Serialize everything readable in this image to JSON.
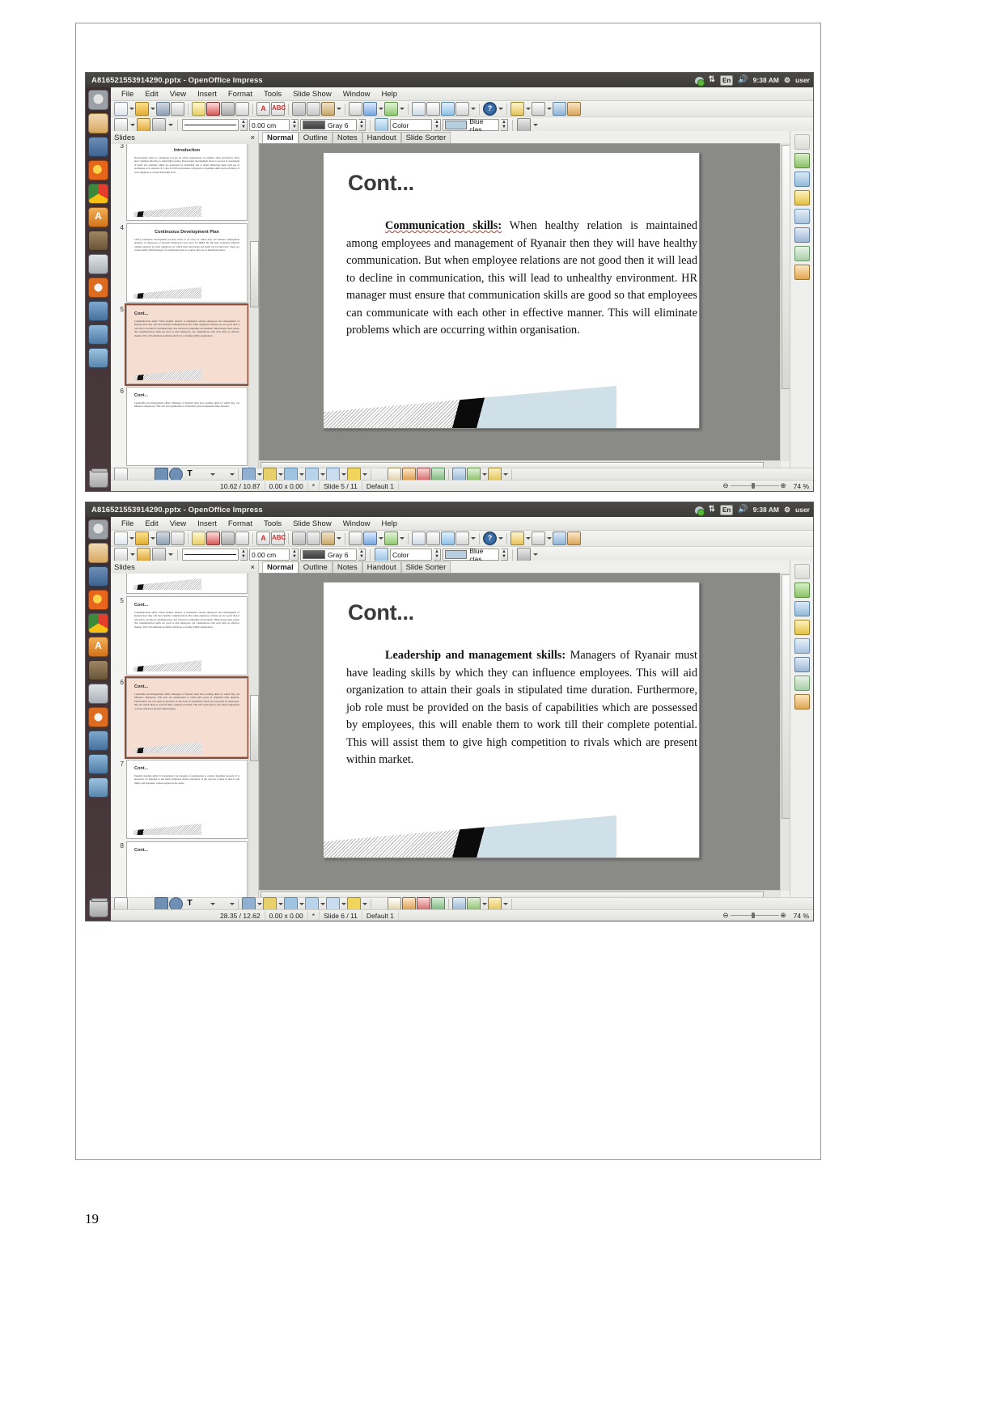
{
  "document": {
    "page_number": "19"
  },
  "windows": [
    {
      "title": "A816521553914290.pptx - OpenOffice Impress",
      "tray": {
        "lang": "En",
        "clock": "9:38 AM",
        "user": "user"
      },
      "menu": [
        "File",
        "Edit",
        "View",
        "Insert",
        "Format",
        "Tools",
        "Slide Show",
        "Window",
        "Help"
      ],
      "formatbar": {
        "line_width": "0.00 cm",
        "line_color": "Gray 6",
        "area_style": "Color",
        "area_color": "Blue clas"
      },
      "slides_pane": {
        "label": "Slides",
        "close": "×"
      },
      "view_tabs": [
        "Normal",
        "Outline",
        "Notes",
        "Handout",
        "Slide Sorter"
      ],
      "active_tab": "Normal",
      "thumbnails": [
        {
          "num": "3",
          "title": "Introduction",
          "title_align": "center",
          "body": "Development refers to continuous process by which organisation can enhance their proficiency. They have common objective to attain high revenue. Professional development refers to process of assessment of skills and qualities which are possessed by individual and is attain enhancing them with use of techniques or be ensured. It is also in CPD professional at Ryanair to maximise skills and proficiency of each employee at overall individual level."
        },
        {
          "num": "4",
          "title": "Continuous Development Plan",
          "title_align": "center",
          "body": "CPD (Continuous development process) refers to an array by which they can enhance employment qualities of employees of Ryanair. Employees have need for HRM. By this they formulate different training sessions for their employees by which their knowledge and skills can be improved. There are various skills which manager of organisation need to acquire, they are as mentioned below:"
        },
        {
          "num": "5",
          "title": "Cont...",
          "title_align": "left",
          "selected": true,
          "body": "Communication skills: When healthy relation is maintained among employees and management of Ryanair then they will have healthy communication. But when employee relations are not good then it will lead to decline in communication, this will lead to unhealthy environment. HR manager must ensure that communication skills are good so that employees can communicate with each other in effective manner. This will eliminate problems which are occurring within organisation."
        },
        {
          "num": "6",
          "title": "Cont...",
          "title_align": "left",
          "body": "Leadership and management skills: Managers of Ryanair must have leading skills by which they can influence employees. This will aid organization to attain their goals in stipulated time duration."
        }
      ],
      "slide": {
        "title": "Cont...",
        "lead": "Communication skills:",
        "body": " When healthy relation is maintained among employees and management of Ryanair then they will have healthy communication. But when employee relations are not good then it will lead to decline in communication, this will lead to unhealthy environment. HR manager must ensure that communication skills are good so that employees can communicate with each other in effective manner. This will eliminate problems which are occurring within organisation."
      },
      "status": {
        "position": "10.62 / 10.87",
        "size": "0.00 x 0.00",
        "modified": "*",
        "slide_counter": "Slide 5 / 11",
        "master": "Default 1",
        "zoom": "74 %"
      }
    },
    {
      "title": "A816521553914290.pptx - OpenOffice Impress",
      "tray": {
        "lang": "En",
        "clock": "9:38 AM",
        "user": "user"
      },
      "menu": [
        "File",
        "Edit",
        "View",
        "Insert",
        "Format",
        "Tools",
        "Slide Show",
        "Window",
        "Help"
      ],
      "formatbar": {
        "line_width": "0.00 cm",
        "line_color": "Gray 6",
        "area_style": "Color",
        "area_color": "Blue clas"
      },
      "slides_pane": {
        "label": "Slides",
        "close": "×"
      },
      "view_tabs": [
        "Normal",
        "Outline",
        "Notes",
        "Handout",
        "Slide Sorter"
      ],
      "active_tab": "Normal",
      "thumbnails": [
        {
          "num": "",
          "title": "",
          "title_align": "left",
          "body": ""
        },
        {
          "num": "5",
          "title": "Cont...",
          "title_align": "left",
          "body": "Communication skills: When healthy relation is maintained among employees and management of Ryanair then they will have healthy communication. But when employee relations are not good then it will lead to decline in communication, this will lead to unhealthy environment. HR manager must ensure that communication skills are good so that employees can communicate with each other in effective manner. This will eliminate problems which are occurring within organisation."
        },
        {
          "num": "6",
          "title": "Cont...",
          "title_align": "left",
          "selected": true,
          "body": "Leadership and management skills: Managers of Ryanair must have leading skills by which they can influence employees. This will aid organization to attain their goals in stipulated time duration. Furthermore, job role must be provided on the basis of capabilities which are possessed by employees, this will enable them to work till their complete potential. This will assist them to give high competition to rivals which are present within market."
        },
        {
          "num": "7",
          "title": "Cont...",
          "title_align": "left",
          "body": "Equality meeting skills: It is mandatory for manager of organisation to conduct meetings properly. It is necessary for manager to use many employee motive structured of the concern, it must be able to run timely and negotiate, various agreed on the assets."
        },
        {
          "num": "8",
          "title": "Cont...",
          "title_align": "left",
          "body": ""
        }
      ],
      "slide": {
        "title": "Cont...",
        "lead": "Leadership and management skills:",
        "body": " Managers of Ryanair must have leading skills by which they can influence employees. This will aid organization to attain their goals in stipulated time duration. Furthermore, job role must be provided on the basis of capabilities which are possessed by employees, this will enable them to work till their complete potential. This will assist them to give high competition to rivals which are present within market."
      },
      "status": {
        "position": "28.35 / 12.62",
        "size": "0.00 x 0.00",
        "modified": "*",
        "slide_counter": "Slide 6 / 11",
        "master": "Default 1",
        "zoom": "74 %"
      }
    }
  ]
}
